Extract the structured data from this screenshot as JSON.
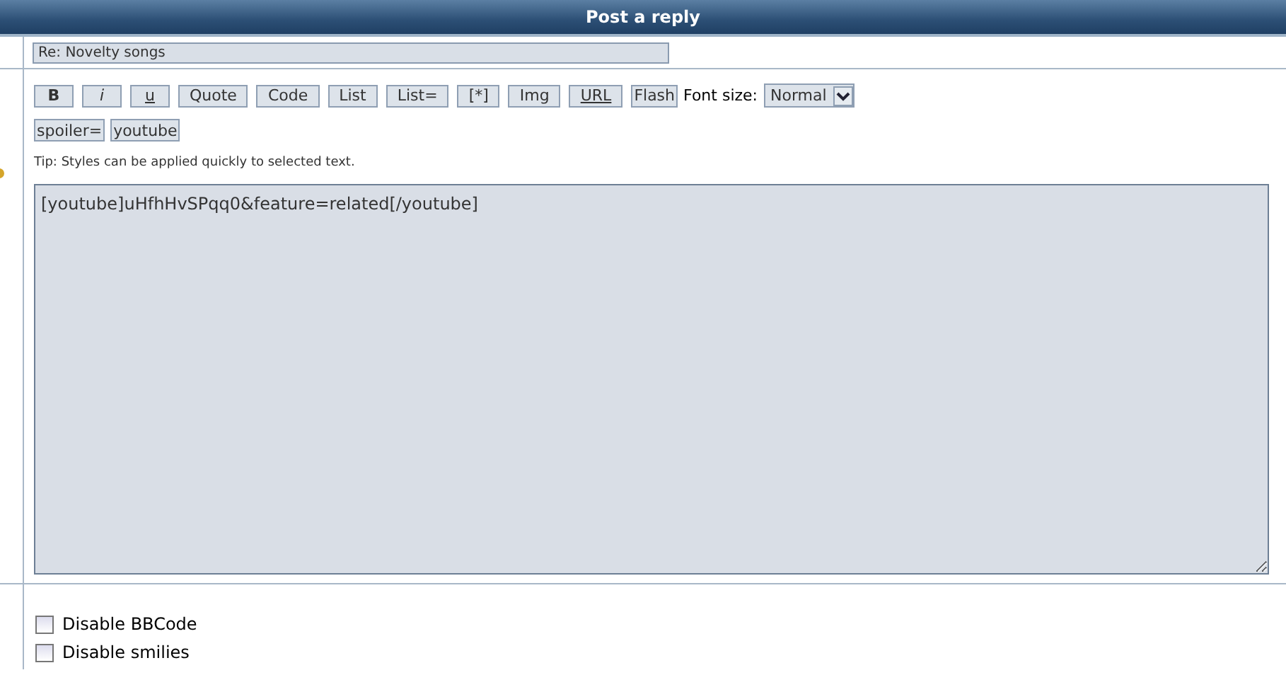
{
  "header": {
    "title": "Post a reply"
  },
  "subject": {
    "value": "Re: Novelty songs"
  },
  "toolbar": {
    "buttons": [
      {
        "label": "B",
        "kind": "bold"
      },
      {
        "label": "i",
        "kind": "italic"
      },
      {
        "label": "u",
        "kind": "underline"
      },
      {
        "label": "Quote",
        "kind": "plain"
      },
      {
        "label": "Code",
        "kind": "plain"
      },
      {
        "label": "List",
        "kind": "plain"
      },
      {
        "label": "List=",
        "kind": "plain"
      },
      {
        "label": "[*]",
        "kind": "plain"
      },
      {
        "label": "Img",
        "kind": "plain"
      },
      {
        "label": "URL",
        "kind": "underline"
      },
      {
        "label": "Flash",
        "kind": "tight"
      },
      {
        "label": "spoiler=",
        "kind": "tight"
      },
      {
        "label": "youtube",
        "kind": "tight"
      }
    ],
    "font_size": {
      "label": "Font size:",
      "value": "Normal"
    }
  },
  "tip": "Tip: Styles can be applied quickly to selected text.",
  "message": {
    "value": "[youtube]uHfhHvSPqq0&feature=related[/youtube]"
  },
  "options": [
    {
      "label": "Disable BBCode",
      "checked": false
    },
    {
      "label": "Disable smilies",
      "checked": false
    }
  ]
}
